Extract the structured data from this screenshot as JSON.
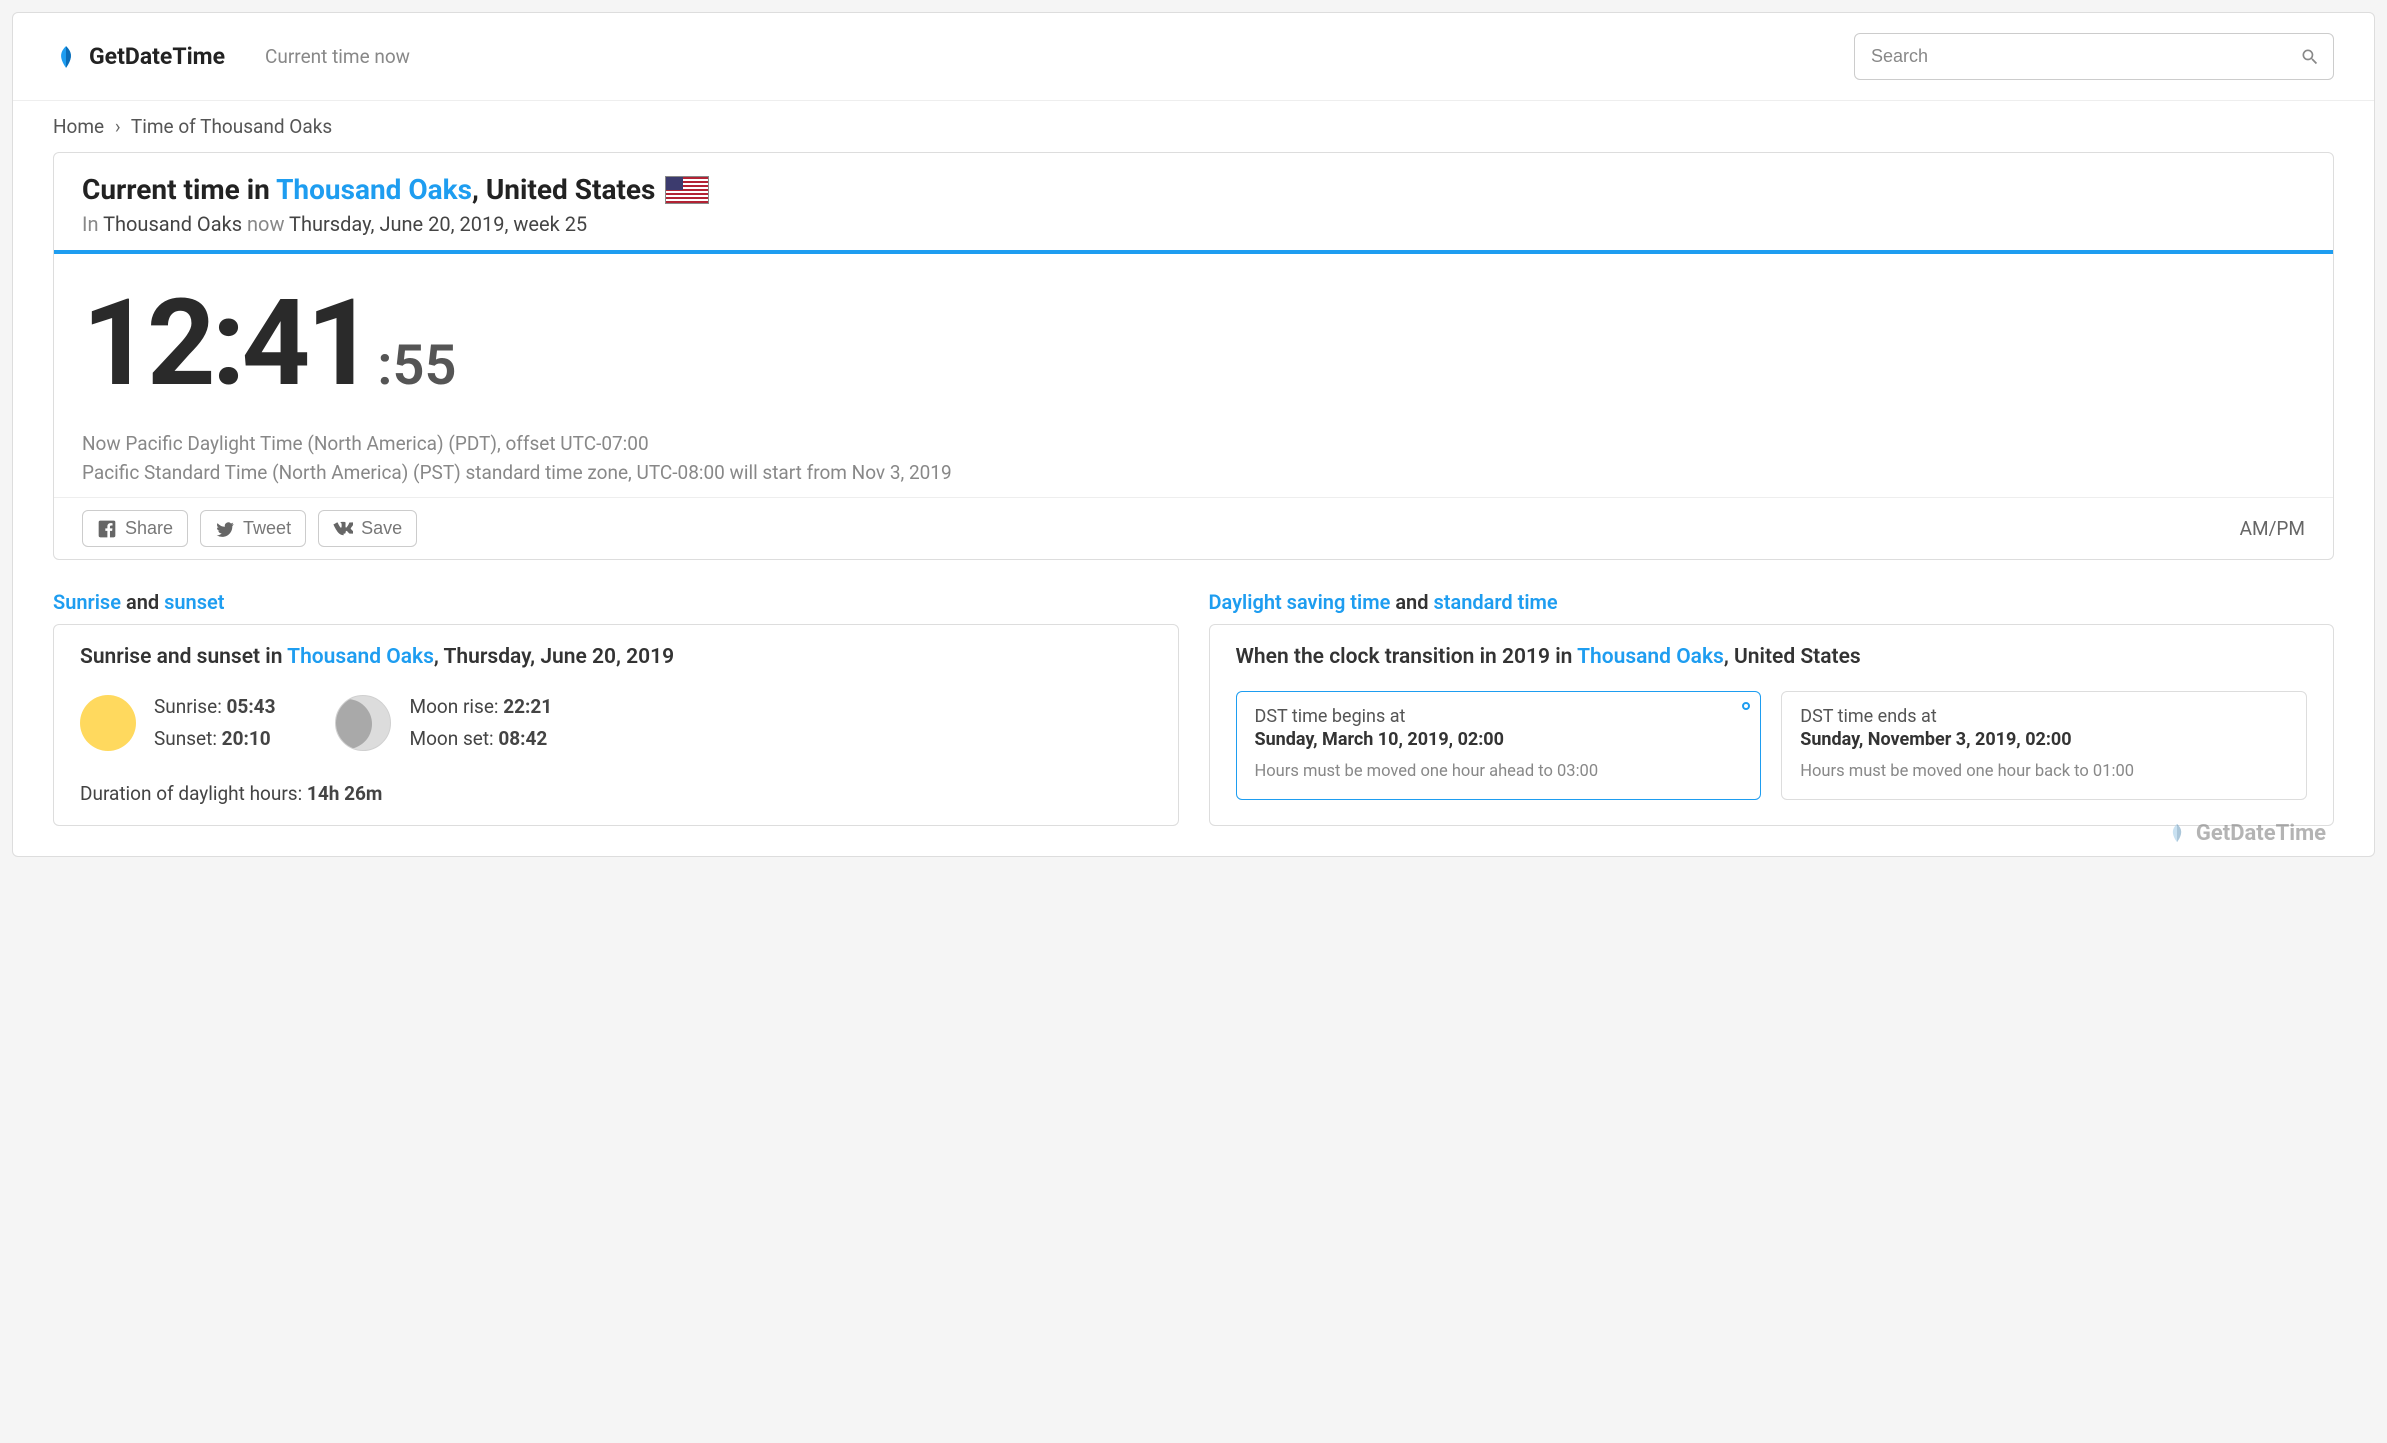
{
  "header": {
    "brand": "GetDateTime",
    "tagline": "Current time now",
    "search_placeholder": "Search"
  },
  "breadcrumb": {
    "home": "Home",
    "current": "Time of Thousand Oaks"
  },
  "title": {
    "prefix": "Current time in ",
    "city": "Thousand Oaks",
    "country_suffix": ", United States"
  },
  "subtitle": {
    "in": "In ",
    "city": "Thousand Oaks",
    "now": " now ",
    "date": "Thursday, June 20, 2019, week 25"
  },
  "clock": {
    "hhmm": "12:41",
    "ss": ":55",
    "tz_line1": "Now Pacific Daylight Time (North America) (PDT), offset UTC-07:00",
    "tz_line2": "Pacific Standard Time (North America) (PST) standard time zone, UTC-08:00 will start from Nov 3, 2019"
  },
  "share": {
    "facebook": "Share",
    "twitter": "Tweet",
    "vk": "Save",
    "ampm": "AM/PM"
  },
  "sunrise_section": {
    "title_a": "Sunrise",
    "title_mid": " and ",
    "title_b": "sunset",
    "panel_title_prefix": "Sunrise and sunset in ",
    "panel_city": "Thousand Oaks",
    "panel_date_suffix": ", Thursday, June 20, 2019",
    "sunrise_label": "Sunrise: ",
    "sunrise_value": "05:43",
    "sunset_label": "Sunset: ",
    "sunset_value": "20:10",
    "moonrise_label": "Moon rise: ",
    "moonrise_value": "22:21",
    "moonset_label": "Moon set: ",
    "moonset_value": "08:42",
    "daylight_label": "Duration of daylight hours: ",
    "daylight_value": "14h 26m"
  },
  "dst_section": {
    "title_a": "Daylight saving time",
    "title_mid": " and ",
    "title_b": "standard time",
    "panel_title_prefix": "When the clock transition in 2019 in ",
    "panel_city": "Thousand Oaks",
    "panel_country_suffix": ", United States",
    "begins_label": "DST time begins at",
    "begins_date": "Sunday, March 10, 2019, 02:00",
    "begins_note": "Hours must be moved one hour ahead to 03:00",
    "ends_label": "DST time ends at",
    "ends_date": "Sunday, November 3, 2019, 02:00",
    "ends_note": "Hours must be moved one hour back to 01:00"
  },
  "watermark": "GetDateTime"
}
